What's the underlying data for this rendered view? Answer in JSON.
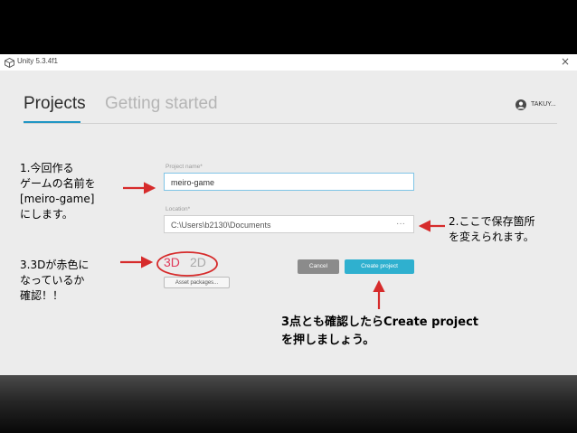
{
  "window": {
    "title": "Unity 5.3.4f1",
    "close_glyph": "×"
  },
  "tabs": [
    {
      "label": "Projects",
      "active": true
    },
    {
      "label": "Getting started",
      "active": false
    }
  ],
  "user": {
    "name": "TAKUY..."
  },
  "form": {
    "project_name_label": "Project name*",
    "project_name_value": "meiro-game",
    "location_label": "Location*",
    "location_value": "C:\\Users\\b2130\\Documents",
    "location_browse": "···",
    "mode_3d": "3D",
    "mode_2d": "2D",
    "selected_mode": "3D",
    "asset_packages_button": "Asset packages...",
    "cancel_button": "Cancel",
    "create_button": "Create project"
  },
  "annotations": {
    "note1": [
      "1.今回作る",
      "ゲームの名前を",
      "[meiro-game]",
      "にします。"
    ],
    "note2": [
      "2.ここで保存箇所",
      "を変えられます。"
    ],
    "note3": [
      "3.3Dが赤色に",
      "なっているか",
      "確認！！"
    ],
    "note4": [
      "3点とも確認したらCreate project",
      "を押しましょう。"
    ]
  },
  "colors": {
    "accent": "#2196c4",
    "create_button": "#2fb0cf",
    "mode_3d": "#e03a5a",
    "annotation_red": "#d62b2b"
  },
  "icons": {
    "logo": "unity-logo-icon",
    "close": "close-icon",
    "avatar": "user-avatar-icon"
  }
}
